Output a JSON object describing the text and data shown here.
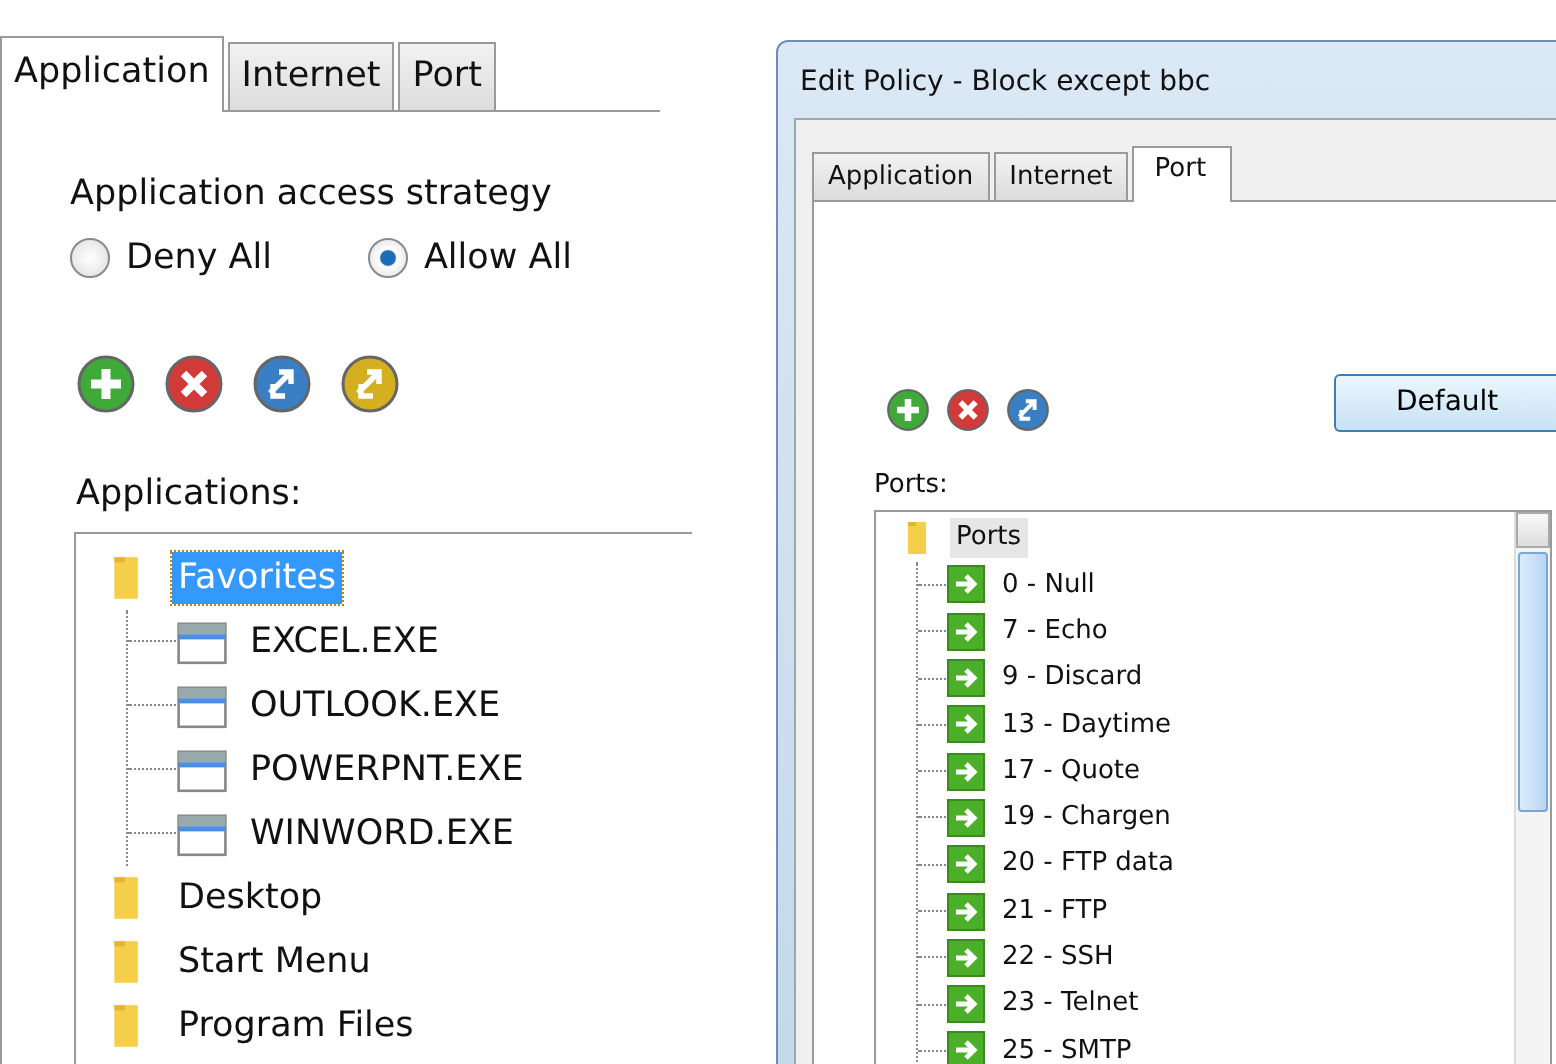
{
  "left_panel": {
    "tabs": [
      {
        "label": "Application",
        "selected": true
      },
      {
        "label": "Internet",
        "selected": false
      },
      {
        "label": "Port",
        "selected": false
      }
    ],
    "strategy": {
      "title": "Application access strategy",
      "options": [
        {
          "label": "Deny All",
          "selected": false
        },
        {
          "label": "Allow All",
          "selected": true
        }
      ]
    },
    "toolbar": [
      {
        "kind": "add"
      },
      {
        "kind": "delete"
      },
      {
        "kind": "refresh"
      },
      {
        "kind": "swap"
      }
    ],
    "list_label": "Applications:",
    "tree": [
      {
        "label": "Favorites",
        "kind": "folder",
        "selected": true,
        "expanded": true,
        "children": [
          {
            "label": "EXCEL.EXE",
            "kind": "app",
            "selected": false
          },
          {
            "label": "OUTLOOK.EXE",
            "kind": "app",
            "selected": false
          },
          {
            "label": "POWERPNT.EXE",
            "kind": "app",
            "selected": false
          },
          {
            "label": "WINWORD.EXE",
            "kind": "app",
            "selected": false
          }
        ]
      },
      {
        "label": "Desktop",
        "kind": "folder",
        "selected": false
      },
      {
        "label": "Start Menu",
        "kind": "folder",
        "selected": false
      },
      {
        "label": "Program Files",
        "kind": "folder",
        "selected": false
      }
    ]
  },
  "right_panel": {
    "window": {
      "title": "Edit Policy - Block except bbc"
    },
    "tabs": [
      {
        "label": "Application",
        "selected": false
      },
      {
        "label": "Internet",
        "selected": false
      },
      {
        "label": "Port",
        "selected": true
      }
    ],
    "toolbar": [
      {
        "kind": "add"
      },
      {
        "kind": "delete"
      },
      {
        "kind": "refresh"
      }
    ],
    "default_button": "Default",
    "list_label": "Ports:",
    "tree": [
      {
        "label": "Ports",
        "kind": "folder",
        "selected": true,
        "expanded": true,
        "children": [
          {
            "label": "0 - Null",
            "kind": "port",
            "selected": false
          },
          {
            "label": "7 - Echo",
            "kind": "port",
            "selected": false
          },
          {
            "label": "9 - Discard",
            "kind": "port",
            "selected": false
          },
          {
            "label": "13 - Daytime",
            "kind": "port",
            "selected": false
          },
          {
            "label": "17 - Quote",
            "kind": "port",
            "selected": false
          },
          {
            "label": "19 - Chargen",
            "kind": "port",
            "selected": false
          },
          {
            "label": "20 - FTP data",
            "kind": "port",
            "selected": false
          },
          {
            "label": "21 - FTP",
            "kind": "port",
            "selected": false
          },
          {
            "label": "22 - SSH",
            "kind": "port",
            "selected": false
          },
          {
            "label": "23 - Telnet",
            "kind": "port",
            "selected": false
          },
          {
            "label": "25 - SMTP",
            "kind": "port",
            "selected": false
          }
        ]
      }
    ]
  }
}
